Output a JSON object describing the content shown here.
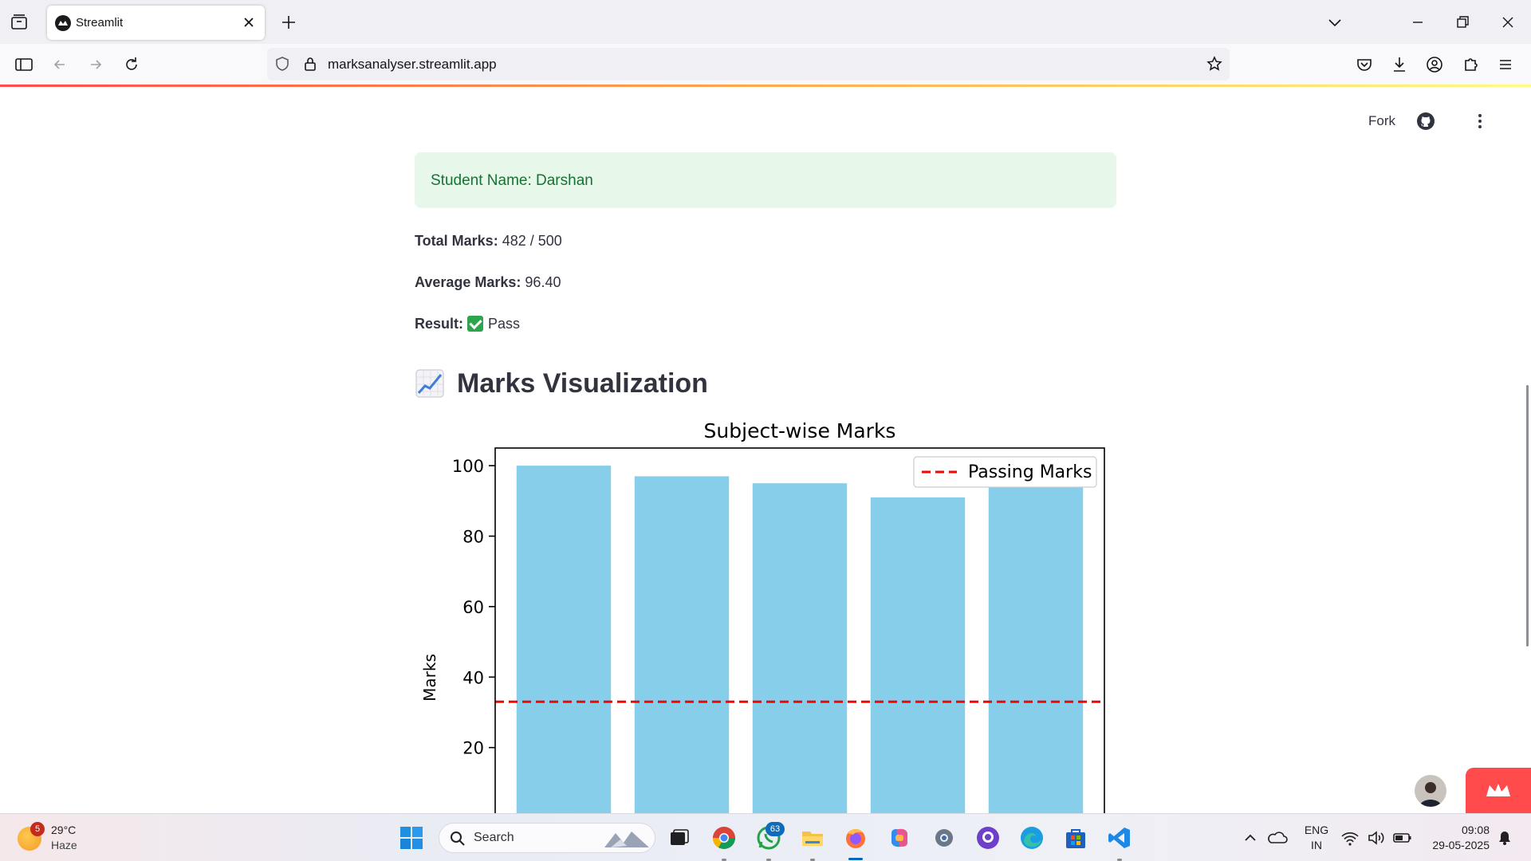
{
  "browser": {
    "tab_title": "Streamlit",
    "url": "marksanalyser.streamlit.app"
  },
  "toolbar": {
    "fork_label": "Fork"
  },
  "report": {
    "student_banner": "Student Name: Darshan",
    "total_label": "Total Marks:",
    "total_value": "482 / 500",
    "average_label": "Average Marks:",
    "average_value": "96.40",
    "result_label": "Result:",
    "result_value": "Pass",
    "section_heading": "Marks Visualization"
  },
  "chart_data": {
    "type": "bar",
    "title": "Subject-wise Marks",
    "xlabel": "",
    "ylabel": "Marks",
    "categories": [
      "",
      "",
      "",
      "",
      ""
    ],
    "values": [
      100,
      97,
      95,
      91,
      99
    ],
    "bar_color": "#87ceeb",
    "ylim": [
      0,
      105
    ],
    "yticks": [
      20,
      40,
      60,
      80,
      100
    ],
    "reference_line": {
      "value": 33,
      "label": "Passing Marks",
      "color": "#ff0000",
      "style": "dashed"
    },
    "legend": "top-right",
    "grid": false
  },
  "taskbar": {
    "weather_badge": "5",
    "temperature": "29°C",
    "condition": "Haze",
    "search_label": "Search",
    "whatsapp_badge": "63",
    "language_top": "ENG",
    "language_bottom": "IN",
    "time": "09:08",
    "date": "29-05-2025"
  },
  "colors": {
    "accent": "#ff4b4b",
    "success_bg": "#e7f7ea",
    "success_text": "#177233"
  }
}
